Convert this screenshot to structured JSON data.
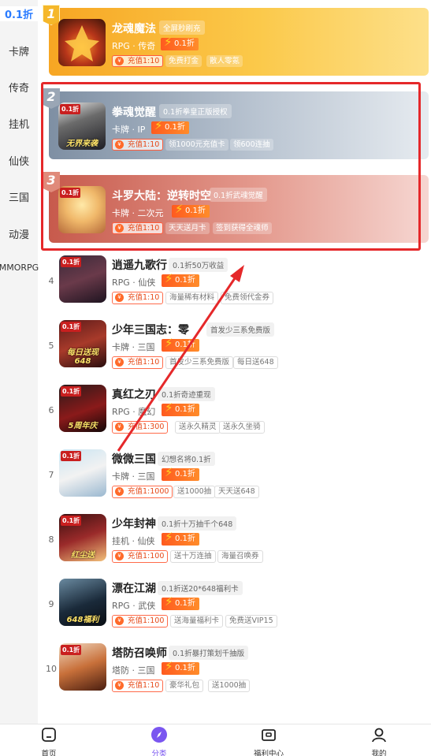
{
  "sidebar": {
    "items": [
      {
        "label": "0.1折"
      },
      {
        "label": "卡牌"
      },
      {
        "label": "传奇"
      },
      {
        "label": "挂机"
      },
      {
        "label": "仙侠"
      },
      {
        "label": "三国"
      },
      {
        "label": "动漫"
      },
      {
        "label": "MMORPG"
      }
    ]
  },
  "top_games": [
    {
      "rank": "1",
      "name": "龙魂魔法",
      "highlight": "全屏秒刷充",
      "genre": "RPG · 传奇",
      "discount": "0.1折",
      "recharge": "充值1:10",
      "perks": [
        "免费打金",
        "散人零氪"
      ],
      "thumb_caption": "",
      "thumb_tag": ""
    },
    {
      "rank": "2",
      "name": "拳魂觉醒",
      "highlight": "0.1折拳皇正版授权",
      "genre": "卡牌 · IP",
      "discount": "0.1折",
      "recharge": "充值1:10",
      "perks": [
        "领1000元充值卡",
        "领600连抽"
      ],
      "thumb_caption": "无界来袭",
      "thumb_tag": "0.1折"
    },
    {
      "rank": "3",
      "name": "斗罗大陆：逆转时空",
      "highlight": "0.1折武魂觉醒",
      "genre": "卡牌 · 二次元",
      "discount": "0.1折",
      "recharge": "充值1:10",
      "perks": [
        "天天送月卡",
        "签到获得全魂师"
      ],
      "thumb_caption": "",
      "thumb_tag": "0.1折"
    }
  ],
  "games": [
    {
      "rank": "4",
      "name": "逍遥九歌行",
      "highlight": "0.1折50万收益",
      "genre": "RPG · 仙侠",
      "discount": "0.1折",
      "recharge": "充值1:10",
      "perks": [
        "海量稀有材料",
        "免费领代金券"
      ],
      "thumb_caption": "",
      "thumb_tag": "0.1折"
    },
    {
      "rank": "5",
      "name": "少年三国志：零",
      "highlight": "首发少三系免费版",
      "genre": "卡牌 · 三国",
      "discount": "0.1折",
      "recharge": "充值1:10",
      "perks": [
        "首发少三系免费版",
        "每日送648"
      ],
      "thumb_caption": "每日送现648",
      "thumb_tag": "0.1折"
    },
    {
      "rank": "6",
      "name": "真红之刃",
      "highlight": "0.1折奇迹重现",
      "genre": "RPG · 魔幻",
      "discount": "0.1折",
      "recharge": "充值1:300",
      "perks": [
        "送永久精灵",
        "送永久坐骑"
      ],
      "thumb_caption": "5周年庆",
      "thumb_tag": "0.1折"
    },
    {
      "rank": "7",
      "name": "微微三国",
      "highlight": "幻想名将0.1折",
      "genre": "卡牌 · 三国",
      "discount": "0.1折",
      "recharge": "充值1:1000",
      "perks": [
        "送1000抽",
        "天天送648"
      ],
      "thumb_caption": "",
      "thumb_tag": "0.1折"
    },
    {
      "rank": "8",
      "name": "少年封神",
      "highlight": "0.1折十万抽千个648",
      "genre": "挂机 · 仙侠",
      "discount": "0.1折",
      "recharge": "充值1:100",
      "perks": [
        "送十万连抽",
        "海量召唤券"
      ],
      "thumb_caption": "红尘送",
      "thumb_tag": "0.1折"
    },
    {
      "rank": "9",
      "name": "漂在江湖",
      "highlight": "0.1折送20*648福利卡",
      "genre": "RPG · 武侠",
      "discount": "0.1折",
      "recharge": "充值1:100",
      "perks": [
        "送海量福利卡",
        "免费送VIP15"
      ],
      "thumb_caption": "648福利",
      "thumb_tag": ""
    },
    {
      "rank": "10",
      "name": "塔防召唤师",
      "highlight": "0.1折暴打策划千抽版",
      "genre": "塔防 · 三国",
      "discount": "0.1折",
      "recharge": "充值1:10",
      "perks": [
        "豪华礼包",
        "送1000抽"
      ],
      "thumb_caption": "",
      "thumb_tag": "0.1折"
    }
  ],
  "bottom_nav": [
    {
      "label": "首页",
      "icon": "home-icon"
    },
    {
      "label": "分类",
      "icon": "compass-icon"
    },
    {
      "label": "福利中心",
      "icon": "gift-box-icon"
    },
    {
      "label": "我的",
      "icon": "user-icon"
    }
  ],
  "colors": {
    "accent": "#2b7cff",
    "annotation": "#e5282a",
    "discount": "#ff6a2a",
    "nav_active": "#7a56f0"
  }
}
